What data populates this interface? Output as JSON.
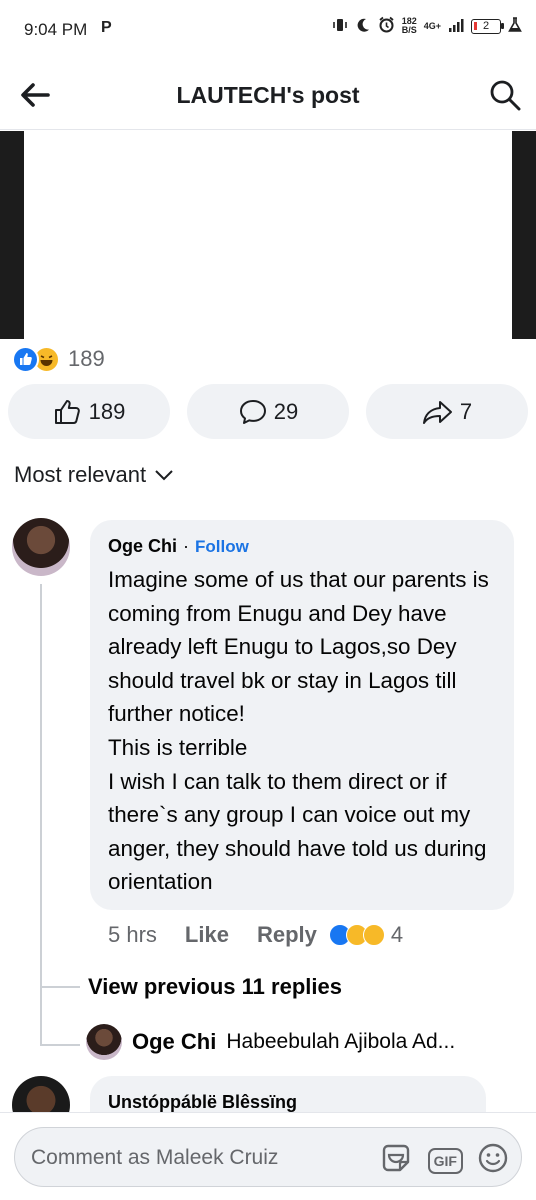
{
  "status_bar": {
    "time": "9:04 PM",
    "notification_glyph": "P",
    "speed_value": "182",
    "speed_unit": "B/S",
    "network": "4G+",
    "battery_level": "2"
  },
  "header": {
    "title": "LAUTECH's post"
  },
  "reactions": {
    "count": "189"
  },
  "actions": {
    "like_count": "189",
    "comment_count": "29",
    "share_count": "7"
  },
  "sort": {
    "label": "Most relevant"
  },
  "comment": {
    "author": "Oge Chi",
    "dot": "·",
    "follow_label": "Follow",
    "text": "Imagine some of us that our parents is coming from Enugu and Dey have already left Enugu to Lagos,so Dey should travel bk or stay in Lagos till further notice!\nThis is terrible\nI wish I can talk to them direct or if there`s any group I can voice out my anger, they should have told us during orientation",
    "time": "5 hrs",
    "like_label": "Like",
    "reply_label": "Reply",
    "reaction_count": "4"
  },
  "replies": {
    "view_previous_label": "View previous 11 replies",
    "latest_author": "Oge Chi",
    "latest_preview": "Habeebulah Ajibola Ad..."
  },
  "next_comment": {
    "author": "Unstóppáblë Blêssïng"
  },
  "composer": {
    "placeholder": "Comment as Maleek Cruiz",
    "gif_label": "GIF"
  },
  "colors": {
    "brand_blue": "#1877f2",
    "follow_blue": "#1b74e4",
    "bubble_bg": "#f0f2f5",
    "secondary_text": "#65676b"
  }
}
